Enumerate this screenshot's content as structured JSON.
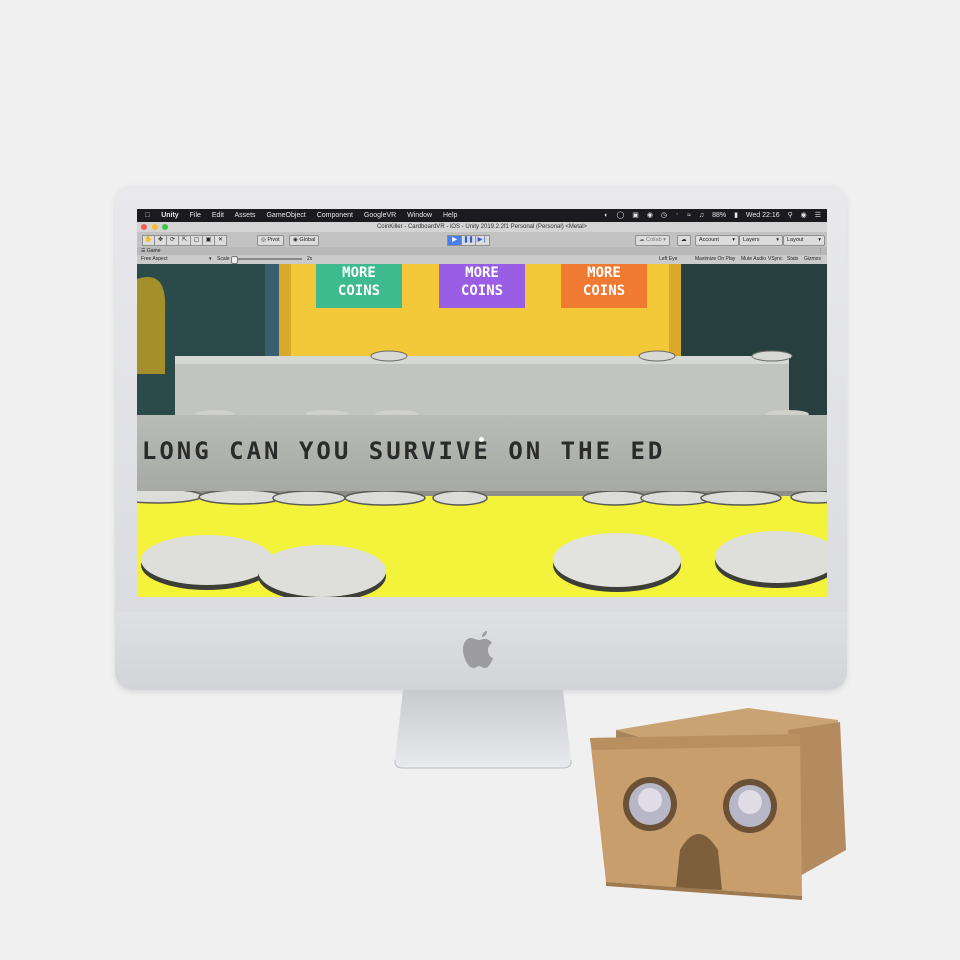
{
  "menubar": {
    "app_name": "Unity",
    "items": [
      "File",
      "Edit",
      "Assets",
      "GameObject",
      "Component",
      "GoogleVR",
      "Window",
      "Help"
    ],
    "battery": "88%",
    "clock": "Wed 22:16"
  },
  "window": {
    "title": "CoinKiller - CardboardVR - iOS - Unity 2019.2.2f1 Personal (Personal) <Metal>"
  },
  "toolbar": {
    "pivot_label": "Pivot",
    "global_label": "Global",
    "collab_label": "Collab",
    "account_label": "Account",
    "layers_label": "Layers",
    "layout_label": "Layout"
  },
  "game_view": {
    "tab_label": "Game",
    "aspect_label": "Free Aspect",
    "scale_label": "Scale",
    "scale_value": "2x",
    "eye_label": "Left Eye",
    "toggles": [
      "Maximize On Play",
      "Mute Audio",
      "VSync",
      "Stats",
      "Gizmos"
    ]
  },
  "scene": {
    "signs": [
      {
        "line1": "MORE",
        "line2": "COINS",
        "color": "#3dbb8f"
      },
      {
        "line1": "MORE",
        "line2": "COINS",
        "color": "#9a5ee4"
      },
      {
        "line1": "MORE",
        "line2": "COINS",
        "color": "#f07a32"
      }
    ],
    "marquee_text": "W LONG CAN YOU SURVIVE ON THE ED",
    "floor_color": "#f4f33c",
    "back_wall_color": "#f3c93a"
  }
}
